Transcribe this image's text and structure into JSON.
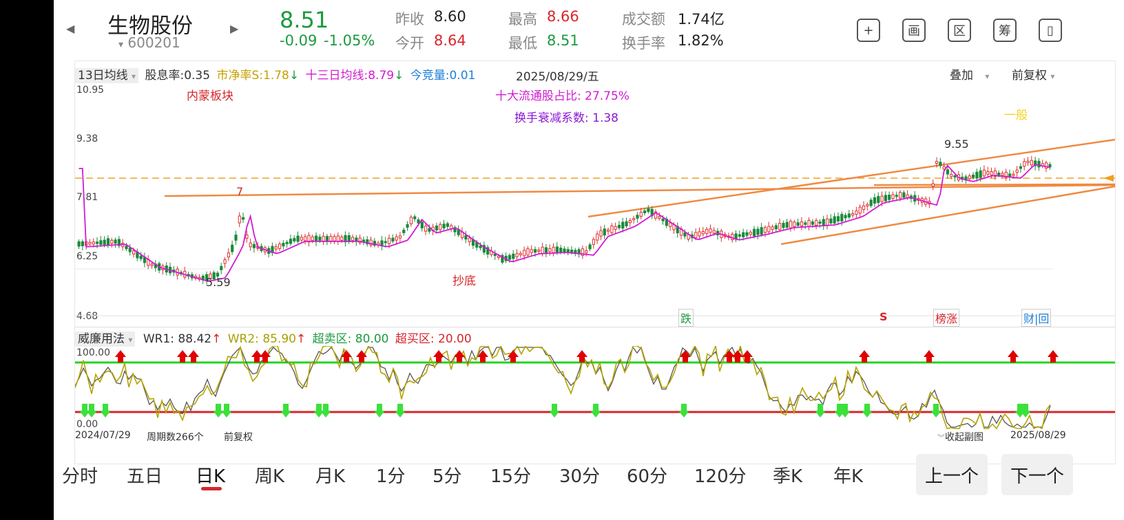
{
  "header": {
    "prev_arrow": "◀",
    "next_arrow": "▶",
    "stock_name": "生物股份",
    "stock_code": "600201",
    "code_caret": "▾",
    "price": "8.51",
    "change": "-0.09",
    "change_pct": "-1.05%",
    "stats": {
      "prev_close_label": "昨收",
      "prev_close": "8.60",
      "open_label": "今开",
      "open": "8.64",
      "high_label": "最高",
      "high": "8.66",
      "low_label": "最低",
      "low": "8.51",
      "amount_label": "成交额",
      "amount": "1.74亿",
      "turnover_label": "换手率",
      "turnover": "1.82%"
    },
    "icons": [
      "add-icon",
      "draw-icon",
      "range-icon",
      "filter-icon",
      "switch-device-icon"
    ],
    "icon_glyphs": [
      "+",
      "画",
      "区",
      "筹",
      "▯"
    ]
  },
  "main_chart": {
    "indicator_select": "13日均线",
    "dividend_label": "股息率:0.35",
    "pb_label": "市净率S:1.78",
    "pb_arrow": "↓",
    "ma13_label": "十三日均线:8.79",
    "ma13_arrow": "↓",
    "auction_label": "今竞量:0.01",
    "date": "2025/08/29/五",
    "overlay_label": "叠加",
    "adjust_label": "前复权",
    "y_ticks": [
      "10.95",
      "9.38",
      "7.81",
      "6.25",
      "4.68"
    ],
    "sector": "内蒙板块",
    "top10_ratio": "十大流通股占比:  27.75%",
    "decay": "换手衰减系数: 1.38",
    "general": "一般",
    "bottom_fish": "抄底",
    "high_mark": "9.55",
    "low_mark": "5.59",
    "peak_mark": "7",
    "tags": {
      "fall": "跌",
      "s": "S",
      "list": "榜涨",
      "report": "财|回"
    },
    "colors": {
      "ma": "#d21ad2",
      "trend": "#ef8a43",
      "up": "#e03030",
      "down": "#1a8a3a",
      "dash": "#f0a020"
    }
  },
  "sub_chart": {
    "name": "威廉用法",
    "wr1": "WR1: 88.42",
    "wr2": "WR2: 85.90",
    "oversold": "超卖区: 80.00",
    "overbought": "超买区: 20.00",
    "up_arrow": "↑",
    "y_top": "100.00",
    "y_bottom": "0.00",
    "start_date": "2024/07/29",
    "period_count": "周期数266个",
    "adjust": "前复权",
    "collapse": "收起副图",
    "end_date": "2025/08/29"
  },
  "period_tabs": [
    "分时",
    "五日",
    "日K",
    "周K",
    "月K",
    "1分",
    "5分",
    "15分",
    "30分",
    "60分",
    "120分",
    "季K",
    "年K"
  ],
  "active_tab": "日K",
  "buttons": {
    "prev": "上一个",
    "next": "下一个"
  }
}
